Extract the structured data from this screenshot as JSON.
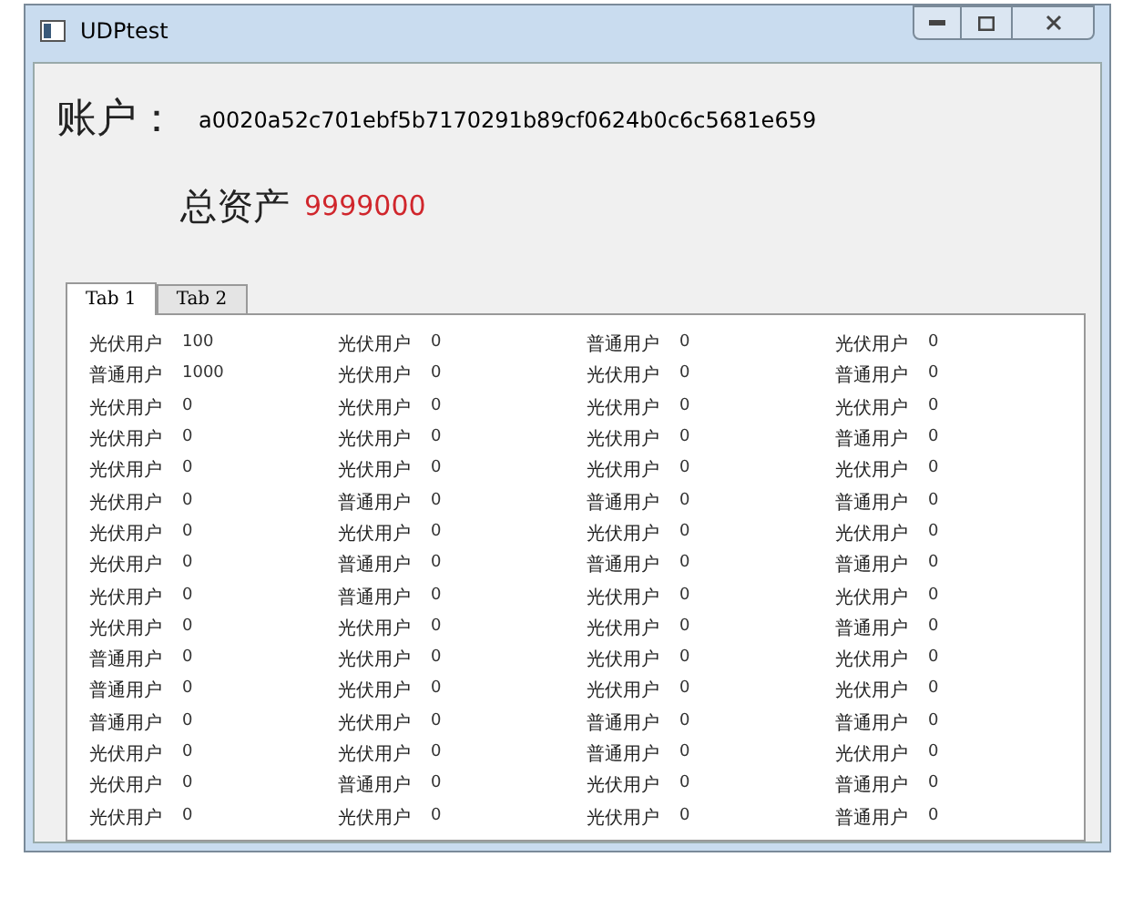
{
  "window": {
    "title": "UDPtest"
  },
  "account": {
    "label": "账户：",
    "value": "a0020a52c701ebf5b7170291b89cf0624b0c6c5681e659"
  },
  "total_assets": {
    "label": "总资产",
    "value": "9999000"
  },
  "tabs": [
    {
      "label": "Tab 1",
      "selected": true
    },
    {
      "label": "Tab 2",
      "selected": false
    }
  ],
  "table": {
    "rows": [
      [
        [
          "光伏用户",
          "100"
        ],
        [
          "光伏用户",
          "0"
        ],
        [
          "普通用户",
          "0"
        ],
        [
          "光伏用户",
          "0"
        ]
      ],
      [
        [
          "普通用户",
          "1000"
        ],
        [
          "光伏用户",
          "0"
        ],
        [
          "光伏用户",
          "0"
        ],
        [
          "普通用户",
          "0"
        ]
      ],
      [
        [
          "光伏用户",
          "0"
        ],
        [
          "光伏用户",
          "0"
        ],
        [
          "光伏用户",
          "0"
        ],
        [
          "光伏用户",
          "0"
        ]
      ],
      [
        [
          "光伏用户",
          "0"
        ],
        [
          "光伏用户",
          "0"
        ],
        [
          "光伏用户",
          "0"
        ],
        [
          "普通用户",
          "0"
        ]
      ],
      [
        [
          "光伏用户",
          "0"
        ],
        [
          "光伏用户",
          "0"
        ],
        [
          "光伏用户",
          "0"
        ],
        [
          "光伏用户",
          "0"
        ]
      ],
      [
        [
          "光伏用户",
          "0"
        ],
        [
          "普通用户",
          "0"
        ],
        [
          "普通用户",
          "0"
        ],
        [
          "普通用户",
          "0"
        ]
      ],
      [
        [
          "光伏用户",
          "0"
        ],
        [
          "光伏用户",
          "0"
        ],
        [
          "光伏用户",
          "0"
        ],
        [
          "光伏用户",
          "0"
        ]
      ],
      [
        [
          "光伏用户",
          "0"
        ],
        [
          "普通用户",
          "0"
        ],
        [
          "普通用户",
          "0"
        ],
        [
          "普通用户",
          "0"
        ]
      ],
      [
        [
          "光伏用户",
          "0"
        ],
        [
          "普通用户",
          "0"
        ],
        [
          "光伏用户",
          "0"
        ],
        [
          "光伏用户",
          "0"
        ]
      ],
      [
        [
          "光伏用户",
          "0"
        ],
        [
          "光伏用户",
          "0"
        ],
        [
          "光伏用户",
          "0"
        ],
        [
          "普通用户",
          "0"
        ]
      ],
      [
        [
          "普通用户",
          "0"
        ],
        [
          "光伏用户",
          "0"
        ],
        [
          "光伏用户",
          "0"
        ],
        [
          "光伏用户",
          "0"
        ]
      ],
      [
        [
          "普通用户",
          "0"
        ],
        [
          "光伏用户",
          "0"
        ],
        [
          "光伏用户",
          "0"
        ],
        [
          "光伏用户",
          "0"
        ]
      ],
      [
        [
          "普通用户",
          "0"
        ],
        [
          "光伏用户",
          "0"
        ],
        [
          "普通用户",
          "0"
        ],
        [
          "普通用户",
          "0"
        ]
      ],
      [
        [
          "光伏用户",
          "0"
        ],
        [
          "光伏用户",
          "0"
        ],
        [
          "普通用户",
          "0"
        ],
        [
          "光伏用户",
          "0"
        ]
      ],
      [
        [
          "光伏用户",
          "0"
        ],
        [
          "普通用户",
          "0"
        ],
        [
          "光伏用户",
          "0"
        ],
        [
          "普通用户",
          "0"
        ]
      ],
      [
        [
          "光伏用户",
          "0"
        ],
        [
          "光伏用户",
          "0"
        ],
        [
          "光伏用户",
          "0"
        ],
        [
          "普通用户",
          "0"
        ]
      ]
    ]
  }
}
